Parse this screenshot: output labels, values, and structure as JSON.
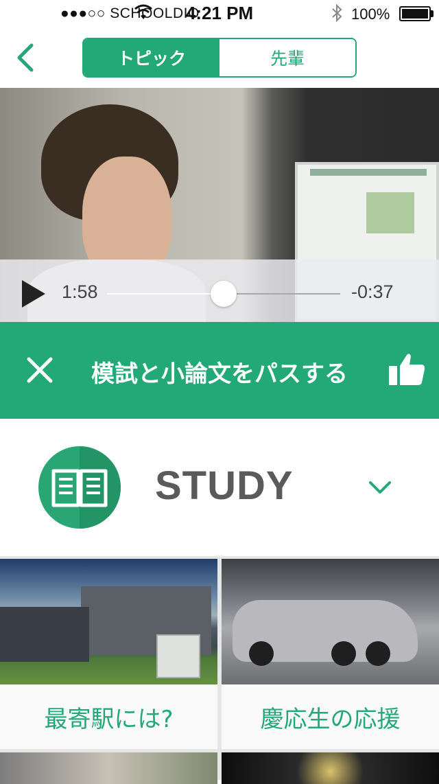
{
  "status_bar": {
    "carrier": "●●●○○ SCHOOLDIO",
    "time": "4:21 PM",
    "battery": "100%"
  },
  "nav": {
    "tabs": [
      {
        "label": "トピック",
        "active": true
      },
      {
        "label": "先輩",
        "active": false
      }
    ]
  },
  "video": {
    "current_time": "1:58",
    "remaining_time": "-0:37",
    "progress": 0.5
  },
  "topic": {
    "title": "模試と小論文をパスする"
  },
  "category": {
    "label": "STUDY",
    "icon": "open-book-icon"
  },
  "tiles": [
    {
      "label": "最寄駅には?"
    },
    {
      "label": "慶応生の応援"
    }
  ],
  "colors": {
    "accent": "#23a877"
  }
}
